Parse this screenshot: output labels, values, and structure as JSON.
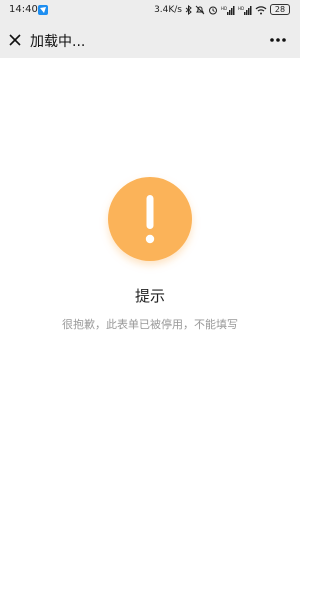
{
  "status_bar": {
    "time": "14:40",
    "network_speed": "3.4K/s",
    "battery_level": "28"
  },
  "nav": {
    "title": "加载中...",
    "close_icon": "close-icon",
    "more_icon": "more-icon"
  },
  "alert": {
    "icon": "exclamation-icon",
    "color": "#fbb359",
    "title": "提示",
    "message": "很抱歉，此表单已被停用，不能填写"
  }
}
